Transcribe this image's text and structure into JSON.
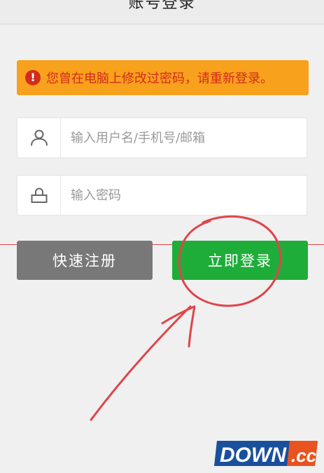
{
  "header": {
    "title": "账号登录"
  },
  "alert": {
    "icon": "exclamation-icon",
    "icon_glyph": "!",
    "text": "您曾在电脑上修改过密码，请重新登录。"
  },
  "form": {
    "username": {
      "icon": "user-icon",
      "placeholder": "输入用户名/手机号/邮箱",
      "value": ""
    },
    "password": {
      "icon": "lock-icon",
      "placeholder": "输入密码",
      "value": ""
    }
  },
  "buttons": {
    "register_label": "快速注册",
    "login_label": "立即登录"
  },
  "watermark": {
    "text": "DOWN.cc"
  },
  "colors": {
    "alert_bg": "#f7a11c",
    "alert_text": "#d42c1c",
    "register_bg": "#787878",
    "login_bg": "#1fad3a",
    "annotation": "#e0444a"
  }
}
